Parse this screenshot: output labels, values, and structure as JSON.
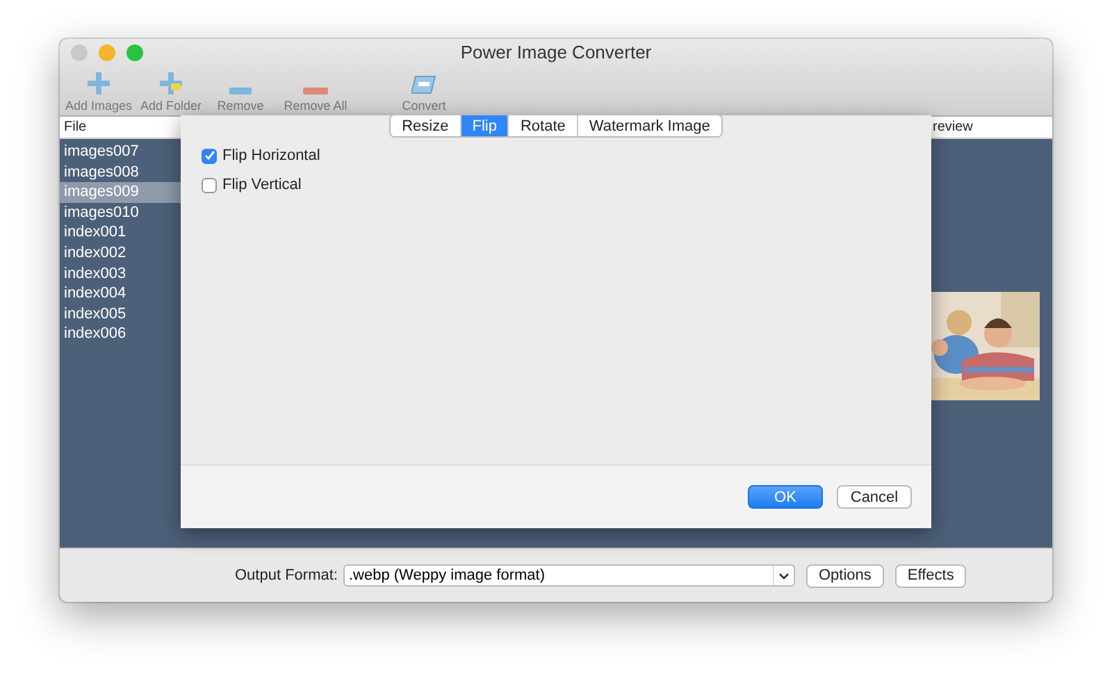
{
  "window": {
    "title": "Power Image Converter"
  },
  "toolbar": [
    {
      "label": "Add Images",
      "kind": "add"
    },
    {
      "label": "Add Folder",
      "kind": "folder"
    },
    {
      "label": "Remove",
      "kind": "remove"
    },
    {
      "label": "Remove All",
      "kind": "remove_all"
    },
    {
      "label": "Convert",
      "kind": "convert"
    }
  ],
  "file_list": {
    "header": "File",
    "items": [
      {
        "name": "images007",
        "selected": false
      },
      {
        "name": "images008",
        "selected": false
      },
      {
        "name": "images009",
        "selected": true
      },
      {
        "name": "images010",
        "selected": false
      },
      {
        "name": "index001",
        "selected": false
      },
      {
        "name": "index002",
        "selected": false
      },
      {
        "name": "index003",
        "selected": false
      },
      {
        "name": "index004",
        "selected": false
      },
      {
        "name": "index005",
        "selected": false
      },
      {
        "name": "index006",
        "selected": false
      }
    ]
  },
  "preview": {
    "header": "review"
  },
  "dialog": {
    "tabs": [
      {
        "label": "Resize",
        "selected": false
      },
      {
        "label": "Flip",
        "selected": true
      },
      {
        "label": "Rotate",
        "selected": false
      },
      {
        "label": "Watermark Image",
        "selected": false
      }
    ],
    "options": [
      {
        "label": "Flip Horizontal",
        "checked": true
      },
      {
        "label": "Flip Vertical",
        "checked": false
      }
    ],
    "buttons": [
      {
        "label": "OK",
        "kind": "primary"
      },
      {
        "label": "Cancel",
        "kind": "secondary"
      }
    ]
  },
  "bottom_bar": {
    "label": "Output Format:",
    "format": ".webp (Weppy image format)",
    "buttons": [
      "Options",
      "Effects"
    ]
  }
}
